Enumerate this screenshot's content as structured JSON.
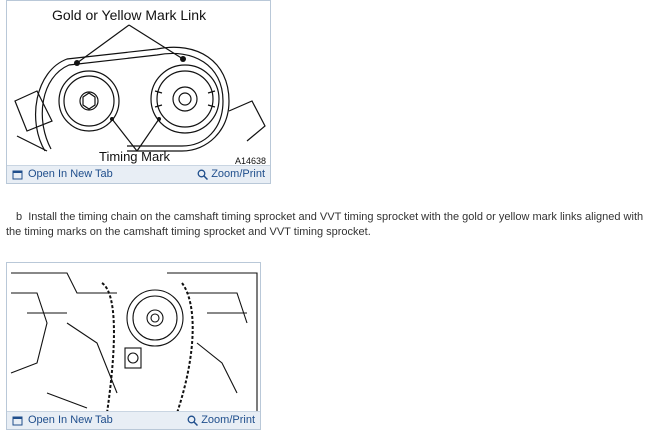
{
  "figure1": {
    "label_top": "Gold or Yellow Mark Link",
    "label_bottom": "Timing Mark",
    "figure_code": "A14638",
    "open_tab_label": "Open In New Tab",
    "zoom_label": "Zoom/Print",
    "open_tab_icon": "open-tab-icon",
    "zoom_icon": "magnifier-icon"
  },
  "step": {
    "marker": "b",
    "text": "Install the timing chain on the camshaft timing sprocket and VVT timing sprocket with the gold or yellow mark links aligned with the timing marks on the camshaft timing sprocket and VVT timing sprocket."
  },
  "figure2": {
    "open_tab_label": "Open In New Tab",
    "zoom_label": "Zoom/Print",
    "open_tab_icon": "open-tab-icon",
    "zoom_icon": "magnifier-icon"
  },
  "colors": {
    "link": "#1f4e8c",
    "bar": "#e8eef5",
    "border": "#b9c8d8"
  }
}
